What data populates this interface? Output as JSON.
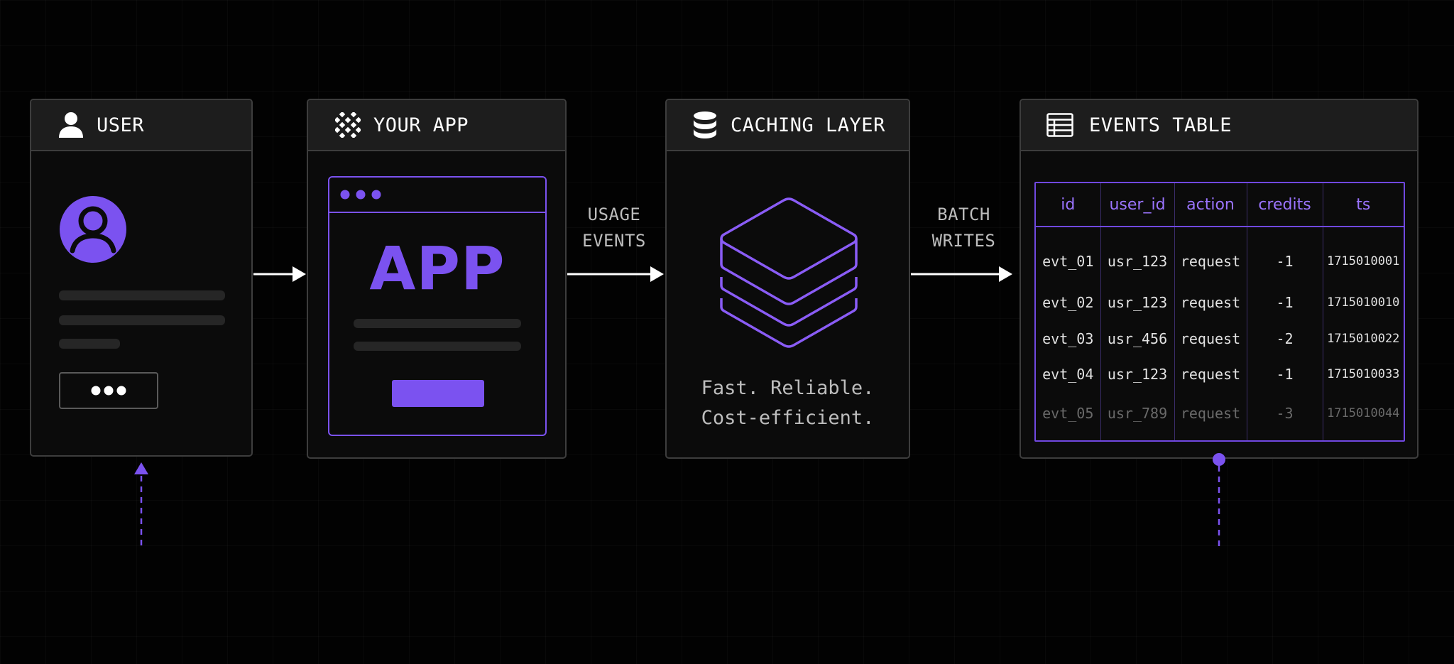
{
  "user_panel": {
    "title": "USER"
  },
  "app_panel": {
    "title": "YOUR APP",
    "app_label": "APP"
  },
  "cache_panel": {
    "title": "CACHING LAYER",
    "tagline_line1": "Fast. Reliable.",
    "tagline_line2": "Cost-efficient."
  },
  "events_panel": {
    "title": "EVENTS TABLE",
    "columns": [
      "id",
      "user_id",
      "action",
      "credits",
      "ts"
    ],
    "rows": [
      [
        "evt_01",
        "usr_123",
        "request",
        "-1",
        "1715010001"
      ],
      [
        "evt_02",
        "usr_123",
        "request",
        "-1",
        "1715010010"
      ],
      [
        "evt_03",
        "usr_456",
        "request",
        "-2",
        "1715010022"
      ],
      [
        "evt_04",
        "usr_123",
        "request",
        "-1",
        "1715010033"
      ],
      [
        "evt_05",
        "usr_789",
        "request",
        "-3",
        "1715010044"
      ]
    ]
  },
  "arrows": {
    "usage_events": [
      "USAGE",
      "EVENTS"
    ],
    "batch_writes": [
      "BATCH",
      "WRITES"
    ]
  },
  "colors": {
    "accent": "#7b52f0",
    "panel_border": "#3d3d3d",
    "header_bg": "#1d1d1d",
    "background": "#020202"
  },
  "icons": [
    "user-icon",
    "app-grid-icon",
    "database-icon",
    "table-icon",
    "avatar-icon",
    "stack-layers-icon"
  ]
}
